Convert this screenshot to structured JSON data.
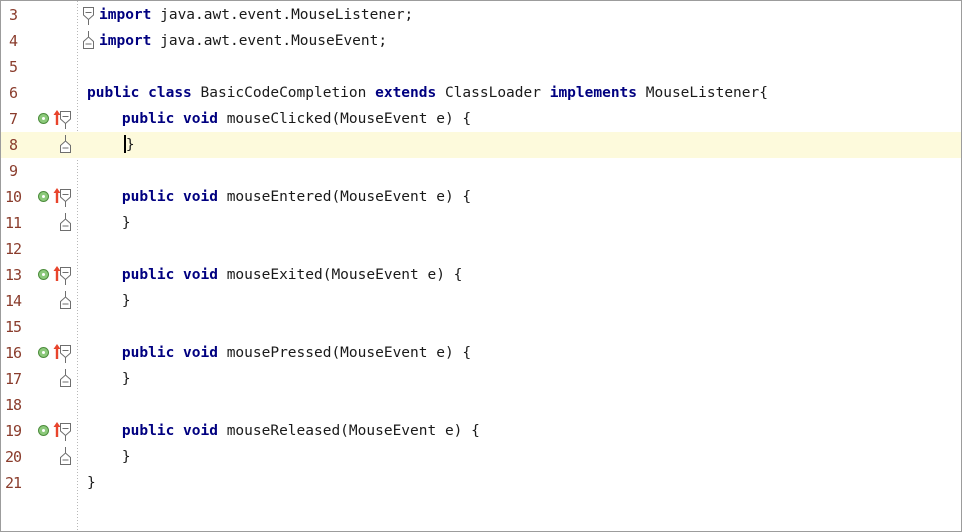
{
  "editor": {
    "lines": [
      {
        "n": "3",
        "tokens": [
          {
            "t": "import",
            "k": true
          },
          {
            "t": " java.awt.event.MouseListener;"
          }
        ],
        "fold": "open",
        "indent": 1
      },
      {
        "n": "4",
        "tokens": [
          {
            "t": "import",
            "k": true
          },
          {
            "t": " java.awt.event.MouseEvent;"
          }
        ],
        "fold": "end",
        "indent": 1
      },
      {
        "n": "5",
        "tokens": []
      },
      {
        "n": "6",
        "tokens": [
          {
            "t": "public",
            "k": true
          },
          {
            "t": " "
          },
          {
            "t": "class",
            "k": true
          },
          {
            "t": " BasicCodeCompletion "
          },
          {
            "t": "extends",
            "k": true
          },
          {
            "t": " ClassLoader "
          },
          {
            "t": "implements",
            "k": true
          },
          {
            "t": " MouseListener{"
          }
        ]
      },
      {
        "n": "7",
        "tokens": [
          {
            "t": "    "
          },
          {
            "t": "public",
            "k": true
          },
          {
            "t": " "
          },
          {
            "t": "void",
            "k": true
          },
          {
            "t": " mouseClicked(MouseEvent e) {"
          }
        ],
        "fold": "open",
        "marker": true
      },
      {
        "n": "8",
        "tokens": [
          {
            "t": "    "
          }
        ],
        "caret": true,
        "after_caret": "}",
        "fold": "end",
        "current": true
      },
      {
        "n": "9",
        "tokens": []
      },
      {
        "n": "10",
        "tokens": [
          {
            "t": "    "
          },
          {
            "t": "public",
            "k": true
          },
          {
            "t": " "
          },
          {
            "t": "void",
            "k": true
          },
          {
            "t": " mouseEntered(MouseEvent e) {"
          }
        ],
        "fold": "open",
        "marker": true
      },
      {
        "n": "11",
        "tokens": [
          {
            "t": "    }"
          }
        ],
        "fold": "end"
      },
      {
        "n": "12",
        "tokens": []
      },
      {
        "n": "13",
        "tokens": [
          {
            "t": "    "
          },
          {
            "t": "public",
            "k": true
          },
          {
            "t": " "
          },
          {
            "t": "void",
            "k": true
          },
          {
            "t": " mouseExited(MouseEvent e) {"
          }
        ],
        "fold": "open",
        "marker": true
      },
      {
        "n": "14",
        "tokens": [
          {
            "t": "    }"
          }
        ],
        "fold": "end"
      },
      {
        "n": "15",
        "tokens": []
      },
      {
        "n": "16",
        "tokens": [
          {
            "t": "    "
          },
          {
            "t": "public",
            "k": true
          },
          {
            "t": " "
          },
          {
            "t": "void",
            "k": true
          },
          {
            "t": " mousePressed(MouseEvent e) {"
          }
        ],
        "fold": "open",
        "marker": true
      },
      {
        "n": "17",
        "tokens": [
          {
            "t": "    }"
          }
        ],
        "fold": "end"
      },
      {
        "n": "18",
        "tokens": []
      },
      {
        "n": "19",
        "tokens": [
          {
            "t": "    "
          },
          {
            "t": "public",
            "k": true
          },
          {
            "t": " "
          },
          {
            "t": "void",
            "k": true
          },
          {
            "t": " mouseReleased(MouseEvent e) {"
          }
        ],
        "fold": "open",
        "marker": true
      },
      {
        "n": "20",
        "tokens": [
          {
            "t": "    }"
          }
        ],
        "fold": "end"
      },
      {
        "n": "21",
        "tokens": [
          {
            "t": "}"
          }
        ]
      }
    ],
    "icons": {
      "annotation": "implements-method-annotation-icon",
      "arrow": "override-up-arrow-icon",
      "fold_open": "fold-collapse-icon",
      "fold_end": "fold-end-icon"
    },
    "colors": {
      "keyword": "#000080",
      "line_number": "#8a3c2c",
      "current_line": "#fdfadc",
      "text": "#1a1a1a"
    }
  }
}
